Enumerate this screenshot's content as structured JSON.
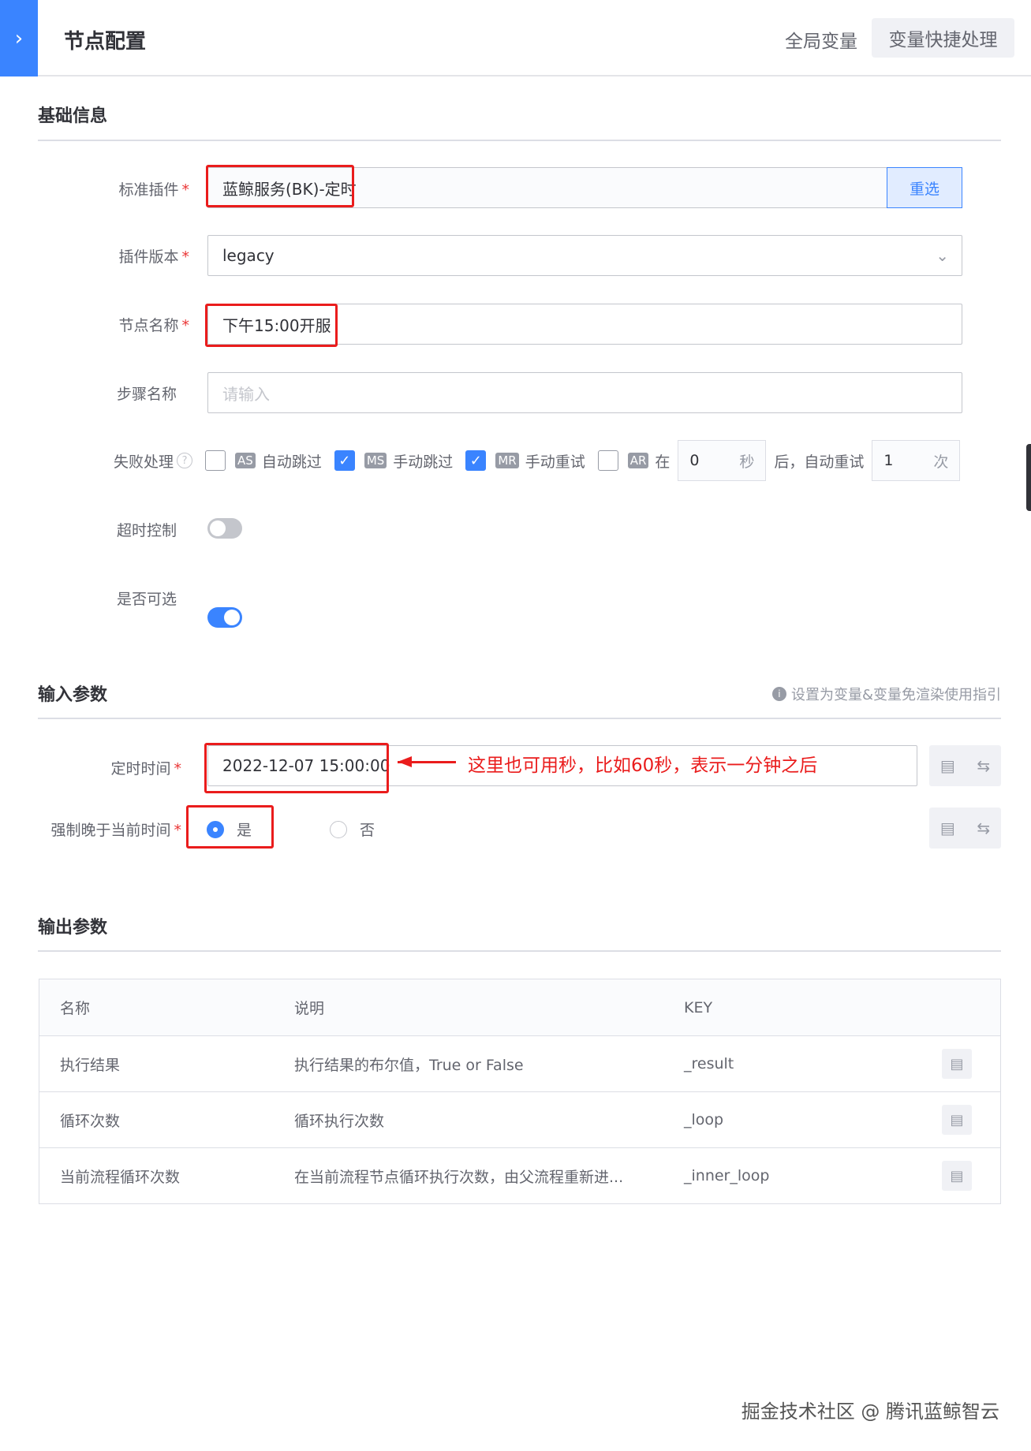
{
  "header": {
    "title": "节点配置",
    "global_vars": "全局变量",
    "quick_vars": "变量快捷处理"
  },
  "basic": {
    "title": "基础信息",
    "plugin": {
      "label": "标准插件",
      "value": "蓝鲸服务(BK)-定时",
      "reselect": "重选"
    },
    "version": {
      "label": "插件版本",
      "value": "legacy"
    },
    "node_name": {
      "label": "节点名称",
      "value": "下午15:00开服"
    },
    "step_name": {
      "label": "步骤名称",
      "placeholder": "请输入"
    },
    "failure": {
      "label": "失败处理",
      "options": [
        {
          "tag": "AS",
          "label": "自动跳过",
          "checked": false
        },
        {
          "tag": "MS",
          "label": "手动跳过",
          "checked": true
        },
        {
          "tag": "MR",
          "label": "手动重试",
          "checked": true
        },
        {
          "tag": "AR",
          "label": "在",
          "checked": false
        }
      ],
      "seconds": "0",
      "seconds_unit": "秒",
      "after": "后，自动重试",
      "times": "1",
      "times_unit": "次"
    },
    "timeout": {
      "label": "超时控制",
      "on": false
    },
    "optional": {
      "label": "是否可选",
      "on": true
    }
  },
  "input": {
    "title": "输入参数",
    "guide": "设置为变量&变量免渲染使用指引",
    "timer": {
      "label": "定时时间",
      "value": "2022-12-07 15:00:00"
    },
    "annotation": "这里也可用秒，比如60秒，表示一分钟之后",
    "force": {
      "label": "强制晚于当前时间",
      "yes": "是",
      "no": "否",
      "selected": "是"
    }
  },
  "output": {
    "title": "输出参数",
    "columns": [
      "名称",
      "说明",
      "KEY"
    ],
    "rows": [
      {
        "name": "执行结果",
        "desc": "执行结果的布尔值，True or False",
        "key": "_result"
      },
      {
        "name": "循环次数",
        "desc": "循环执行次数",
        "key": "_loop"
      },
      {
        "name": "当前流程循环次数",
        "desc": "在当前流程节点循环执行次数，由父流程重新进...",
        "key": "_inner_loop"
      }
    ]
  },
  "watermark": "掘金技术社区 @ 腾讯蓝鲸智云",
  "colors": {
    "primary": "#3a84ff",
    "highlight": "#ea1c1c"
  }
}
